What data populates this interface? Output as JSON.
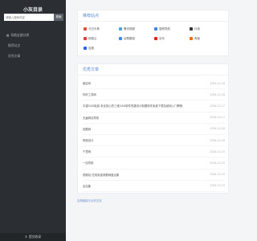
{
  "sidebar": {
    "title": "小灰目录",
    "search": {
      "placeholder": "请输入搜索内容",
      "button": "搜索"
    },
    "items": [
      {
        "label": "导航全部分类",
        "type": "main"
      },
      {
        "label": "推荐站点",
        "type": "sub"
      },
      {
        "label": "优秀文章",
        "type": "sub"
      }
    ],
    "footer": "提交收录"
  },
  "recommend": {
    "title": "推荐站点",
    "sites": [
      {
        "label": "今日头条",
        "color": "#e64b3c"
      },
      {
        "label": "腾讯视频",
        "color": "#4aa3df"
      },
      {
        "label": "搜狗导航",
        "color": "#3b86e0"
      },
      {
        "label": "抖音",
        "color": "#333333"
      },
      {
        "label": "网易云",
        "color": "#e03c3c"
      },
      {
        "label": "谷歌翻译",
        "color": "#4285f4"
      },
      {
        "label": "京东",
        "color": "#e1251b"
      },
      {
        "label": "淘宝",
        "color": "#ff6a00"
      },
      {
        "label": "百度",
        "color": "#2d62e8"
      }
    ]
  },
  "articles": {
    "title": "优秀文章",
    "items": [
      {
        "title": "馨如何",
        "date": "2024-12-18"
      },
      {
        "title": "你好工具网",
        "date": "2024-12-18"
      },
      {
        "title": "中望CAD免费-安全放心的三维CAD软件的建设计制图软件免费下载及使用入门教程",
        "date": "2024-12-17"
      },
      {
        "title": "无遍网站导航",
        "date": "2024-12-17"
      },
      {
        "title": "炫酷网",
        "date": "2024-12-16"
      },
      {
        "title": "网络设计",
        "date": "2024-12-16"
      },
      {
        "title": "千里网",
        "date": "2024-12-15"
      },
      {
        "title": "一站导航",
        "date": "2024-12-15"
      },
      {
        "title": "视频站-在线免费观看网盘合集",
        "date": "2024-12-15"
      },
      {
        "title": "友站集",
        "date": "2024-12-15"
      }
    ]
  },
  "footer_link": "友情链接与合作交流"
}
